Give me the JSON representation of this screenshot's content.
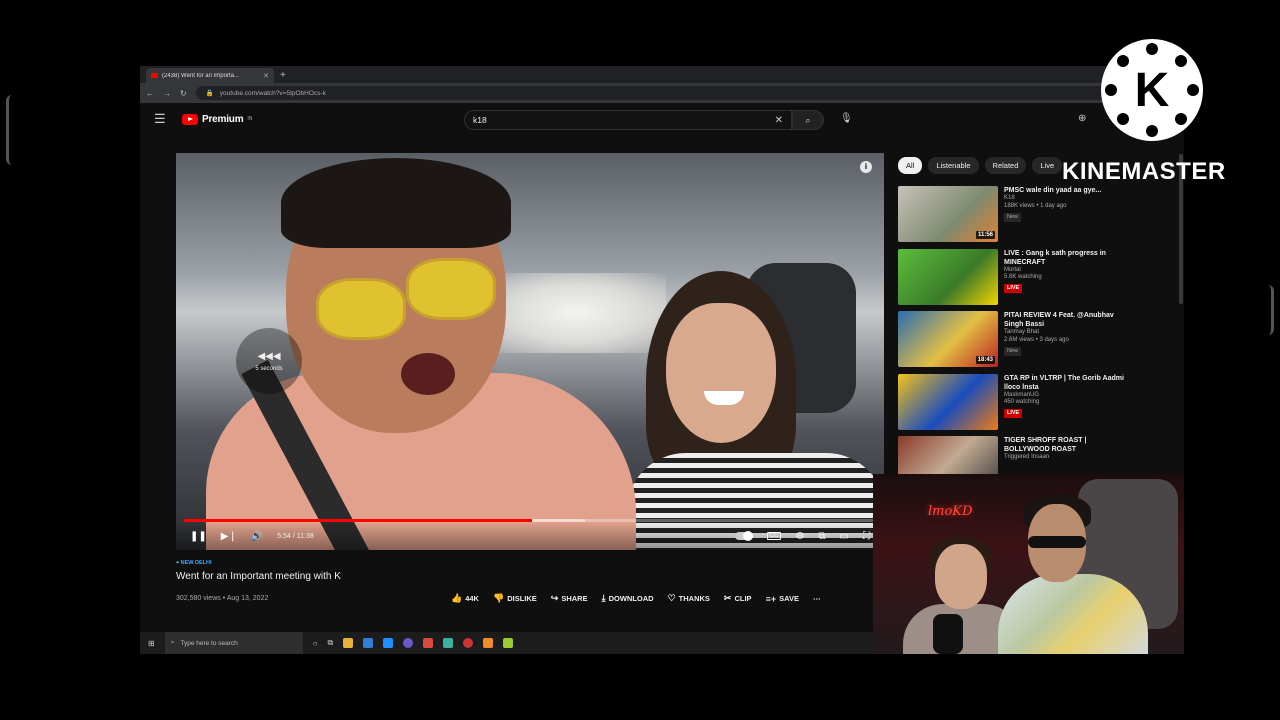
{
  "browser": {
    "tab_title": "(2438) Went for an Importa...",
    "new_tab": "+",
    "url": "youtube.com/watch?v=5tpObHOcs-k"
  },
  "header": {
    "brand": "Premium",
    "brand_sup": "IN",
    "search_query": "k18"
  },
  "video": {
    "seek_overlay": "5 seconds",
    "time": "5:54 / 11:38",
    "progress_fraction": 0.503,
    "loaded_fraction": 0.58,
    "location": "NEW DELHI",
    "title": "Went for an Important meeting with K",
    "views_date": "302,580 views • Aug 13, 2022"
  },
  "actions": {
    "like": "44K",
    "dislike": "DISLIKE",
    "share": "SHARE",
    "download": "DOWNLOAD",
    "thanks": "THANKS",
    "clip": "CLIP",
    "save": "SAVE"
  },
  "chips": [
    "All",
    "Listenable",
    "Related",
    "Live"
  ],
  "recommendations": [
    {
      "title": "PMSC wale din yaad aa gye...",
      "channel": "K18",
      "meta": "188K views • 1 day ago",
      "badge": "New",
      "duration": "11:56"
    },
    {
      "title": "LIVE : Gang k sath progress in MINECRAFT",
      "channel": "Mortal",
      "meta": "5.8K watching",
      "badge": "LIVE",
      "duration": ""
    },
    {
      "title": "PITAI REVIEW 4 Feat. @Anubhav Singh Bassi",
      "channel": "Tanmay Bhat",
      "meta": "2.6M views • 3 days ago",
      "badge": "New",
      "duration": "18:43"
    },
    {
      "title": "GTA RP in VLTRP | The Gorib Aadmi lloco lnsta",
      "channel": "MaskmanUG",
      "meta": "450 watching",
      "badge": "LIVE",
      "duration": ""
    },
    {
      "title": "TIGER SHROFF ROAST | BOLLYWOOD ROAST",
      "channel": "Triggered Insaan",
      "meta": "",
      "badge": "",
      "duration": ""
    }
  ],
  "taskbar": {
    "search_placeholder": "Type here to search"
  },
  "watermark": {
    "text": "KINEMASTER",
    "logo_letter": "K"
  },
  "webcam": {
    "neon_sign": "lmoKD"
  },
  "colors": {
    "accent_red": "#ff0000",
    "link_blue": "#3ea6ff",
    "background": "#0f0f0f"
  }
}
